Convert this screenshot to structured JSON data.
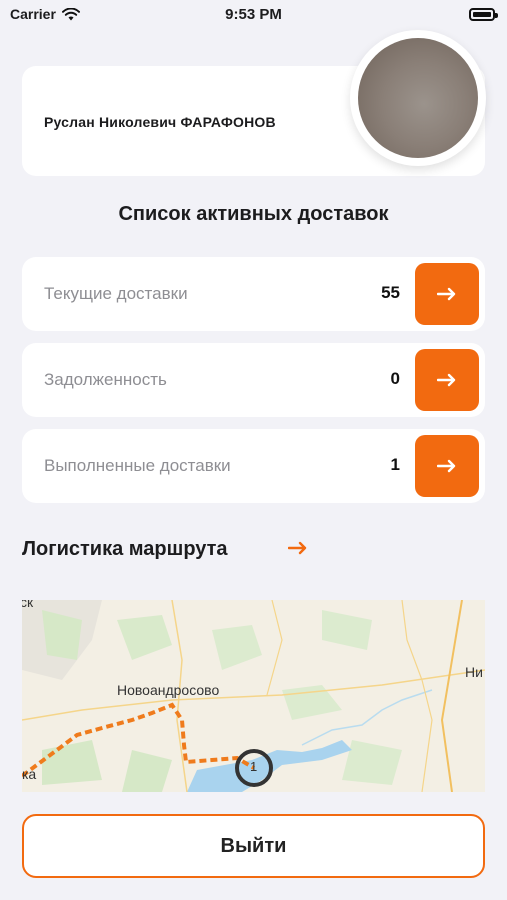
{
  "status_bar": {
    "carrier": "Carrier",
    "time": "9:53 PM",
    "battery_level": 1.0
  },
  "profile": {
    "name": "Руслан Николевич ФАРАФОНОВ"
  },
  "deliveries": {
    "title": "Список активных доставок",
    "items": [
      {
        "label": "Текущие доставки",
        "count": "55"
      },
      {
        "label": "Задолженность",
        "count": "0"
      },
      {
        "label": "Выполненные доставки",
        "count": "1"
      }
    ]
  },
  "logistics": {
    "title": "Логистика маршрута",
    "map_labels": {
      "town": "Новоандросово",
      "top_left": "ск",
      "right": "Ни",
      "bottom_left": "ка",
      "marker": "1"
    }
  },
  "logout": {
    "label": "Выйти"
  },
  "colors": {
    "accent": "#f26a10",
    "background": "#f2f2f7"
  }
}
